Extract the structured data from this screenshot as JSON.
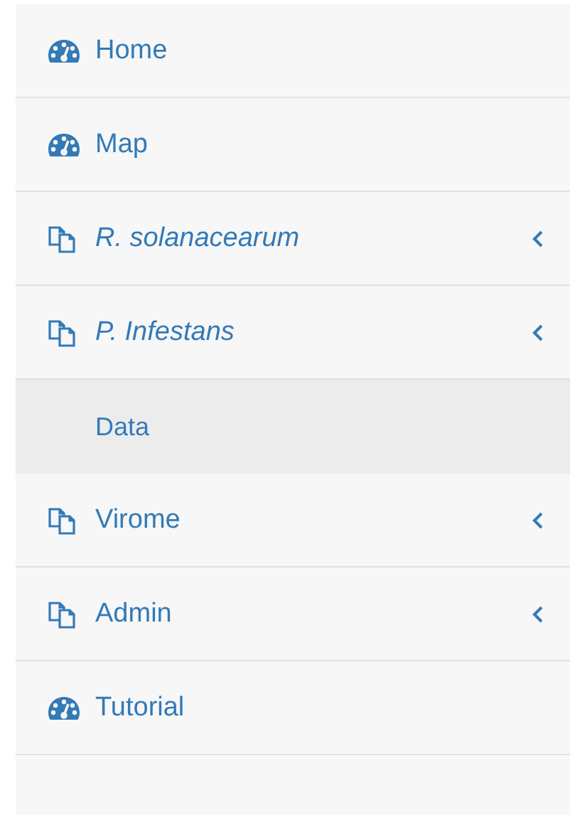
{
  "sidebar": {
    "items": [
      {
        "label": "Home",
        "kind": "page",
        "italic": false
      },
      {
        "label": "Map",
        "kind": "page",
        "italic": false
      },
      {
        "label": "R. solanacearum",
        "kind": "menu",
        "italic": true
      },
      {
        "label": "P. Infestans",
        "kind": "menu",
        "italic": true,
        "children": [
          {
            "label": "Data"
          }
        ]
      },
      {
        "label": "Virome",
        "kind": "menu",
        "italic": false
      },
      {
        "label": "Admin",
        "kind": "menu",
        "italic": false
      },
      {
        "label": "Tutorial",
        "kind": "page",
        "italic": false
      }
    ]
  }
}
